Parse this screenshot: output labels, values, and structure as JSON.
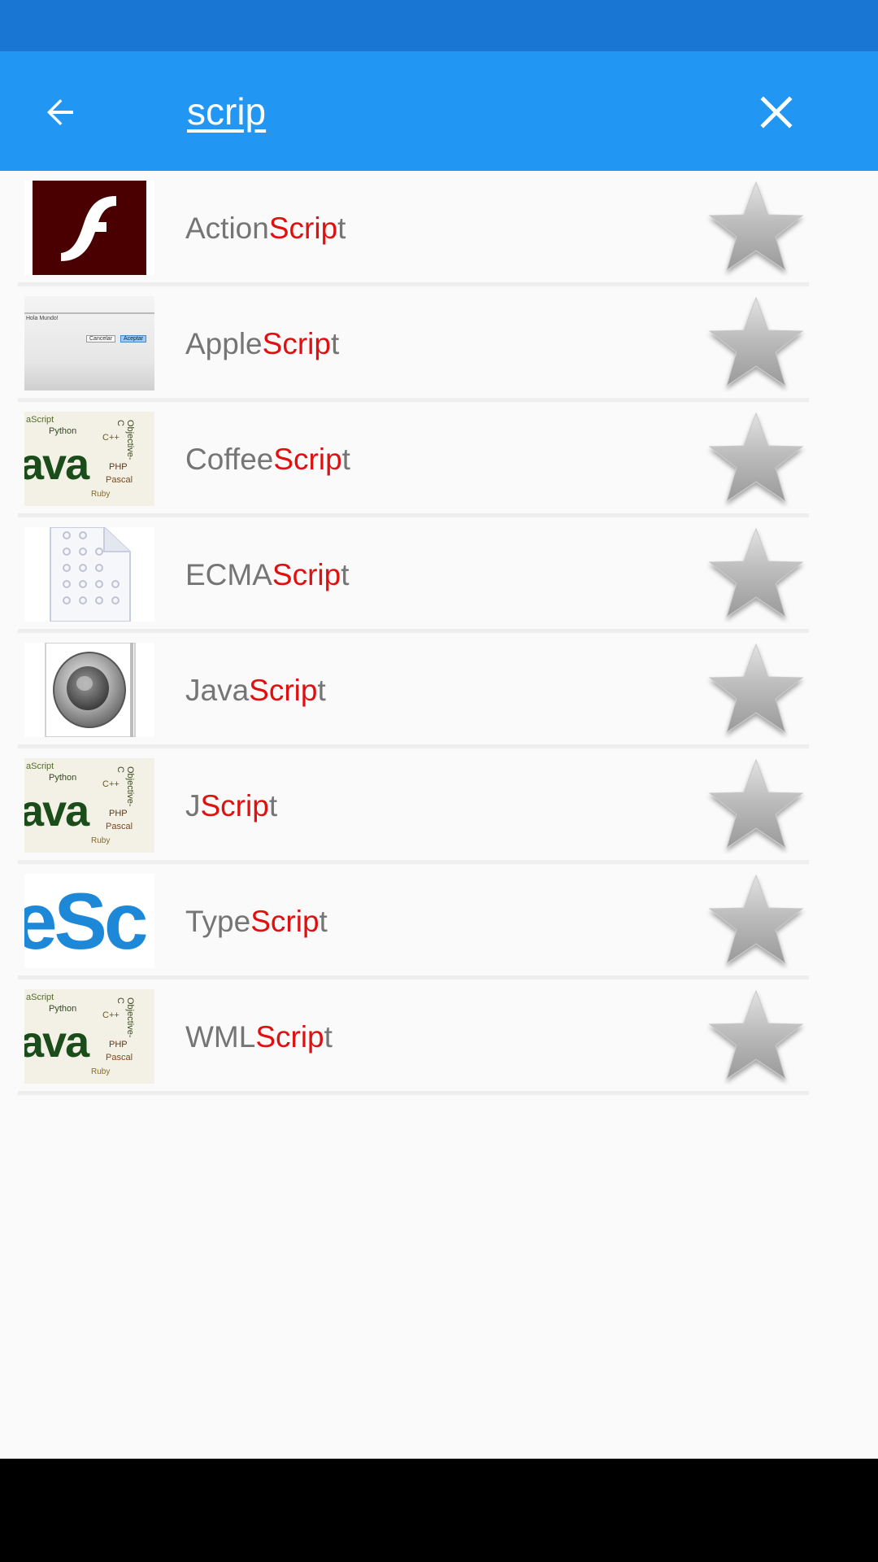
{
  "header": {
    "search_value": "scrip",
    "back_icon": "arrow-left-icon",
    "clear_icon": "close-icon"
  },
  "colors": {
    "status_bar": "#1976d2",
    "app_bar": "#2196f3",
    "highlight": "#e01010",
    "label": "#757575"
  },
  "results": [
    {
      "prefix": "Action",
      "match": "Scrip",
      "suffix": "t",
      "thumbnail": "flash-logo"
    },
    {
      "prefix": "Apple",
      "match": "Scrip",
      "suffix": "t",
      "thumbnail": "dialog-screenshot"
    },
    {
      "prefix": "Coffee",
      "match": "Scrip",
      "suffix": "t",
      "thumbnail": "word-cloud"
    },
    {
      "prefix": "ECMA",
      "match": "Scrip",
      "suffix": "t",
      "thumbnail": "document-icon"
    },
    {
      "prefix": "Java",
      "match": "Scrip",
      "suffix": "t",
      "thumbnail": "speaker-icon"
    },
    {
      "prefix": "J",
      "match": "Scrip",
      "suffix": "t",
      "thumbnail": "word-cloud"
    },
    {
      "prefix": "Type",
      "match": "Scrip",
      "suffix": "t",
      "thumbnail": "typescript-logo"
    },
    {
      "prefix": "WML",
      "match": "Scrip",
      "suffix": "t",
      "thumbnail": "word-cloud"
    }
  ],
  "thumbnail_text": {
    "dialog_message": "Hola Mundo!",
    "dialog_cancel": "Cancelar",
    "dialog_ok": "Aceptar",
    "ts_fragment": "eSc",
    "cloud_main": "ava",
    "cloud_words": [
      "Python",
      "C++",
      "PHP",
      "Pascal",
      "Objective-C",
      "Ruby",
      "aScript"
    ]
  }
}
